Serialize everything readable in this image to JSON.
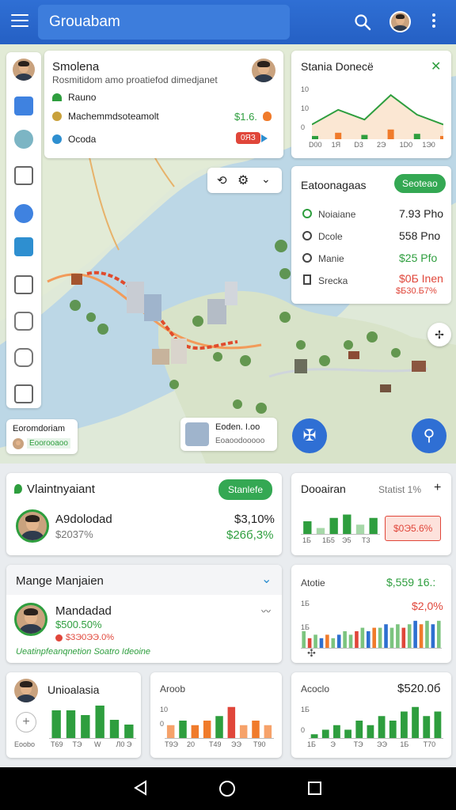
{
  "app": {
    "title": "Grouabam"
  },
  "colors": {
    "primary": "#2f6fd4",
    "green": "#2e9e3e",
    "red": "#e0463a",
    "orange": "#f07b2b"
  },
  "overview_card": {
    "title": "Smolena",
    "subtitle": "Rosmitidom amo proatiefod dimedjanet",
    "rows": [
      {
        "icon": "leaf-icon",
        "label": "Rauno",
        "value": "",
        "badge": ""
      },
      {
        "icon": "coin-icon",
        "label": "Machemmdsoteamolt",
        "value": "$1.6.",
        "badge": ""
      },
      {
        "icon": "location-icon",
        "label": "Ocoda",
        "value": "",
        "badge": "0ЯЗ"
      }
    ]
  },
  "stats_card": {
    "title": "Stania Doneсё",
    "x_labels": [
      "D00",
      "1Я",
      "D3",
      "2Э",
      "1D0",
      "1Э0"
    ],
    "y_labels": [
      "10",
      "10",
      "0"
    ],
    "chart_data": {
      "type": "area",
      "categories": [
        "D00",
        "1Я",
        "D3",
        "2Э",
        "1D0",
        "1Э0"
      ],
      "series": [
        {
          "values": [
            3,
            6,
            4,
            9,
            5,
            3
          ]
        }
      ],
      "ylim": [
        0,
        10
      ]
    }
  },
  "budget_card": {
    "title": "Eatoonagaas",
    "button": "Seoteao",
    "rows": [
      {
        "icon": "location-icon",
        "label": "Noiaiane",
        "value": "7.93 Pho",
        "sub": ""
      },
      {
        "icon": "clock-icon",
        "label": "Dcole",
        "value": "558 Pno",
        "sub": ""
      },
      {
        "icon": "clock-icon",
        "label": "Manie",
        "value": "$25 Pfo",
        "sub": ""
      },
      {
        "icon": "document-icon",
        "label": "Srecka",
        "value": "$0Б Inen",
        "sub": "$Б30.Б7%"
      }
    ]
  },
  "map": {
    "controls": [
      "undo-icon",
      "settings-icon",
      "chevron-down-icon"
    ],
    "chip_left": {
      "title": "Eoromdoriam",
      "sub": "Eoorooaoo"
    },
    "chip_right": {
      "title": "Eoden. I.oo",
      "sub": "Eoaoodooooo"
    }
  },
  "maint_card": {
    "title": "Vlaintnyaiant",
    "button": "Stanlefe",
    "name": "A9dolodad",
    "sub": "$2037%",
    "value": "$3,10%",
    "value2": "$26б,3%"
  },
  "doc_card": {
    "title": "Dooairan",
    "right": "Statist 1%",
    "badge": "$0Э5.6%",
    "x_labels": [
      "1Б",
      "1Б5",
      "Э5",
      "Т3"
    ],
    "chart_data": {
      "type": "bar",
      "categories": [
        "1Б",
        "1Б5",
        "Э5",
        "Т3"
      ],
      "series": [
        {
          "values": [
            4,
            2,
            5,
            6,
            3,
            5
          ]
        }
      ],
      "ylim": [
        0,
        8
      ]
    }
  },
  "manage_card": {
    "title": "Mange Manjaien",
    "name": "Mandadad",
    "v1": "$500.50%",
    "v2": "$3Э0ЭЭ.0%",
    "footer": "Ueatinpfeanqnetion Soatro Ideoine"
  },
  "trend_card": {
    "title": "Atotie",
    "value": "$,559 16.:",
    "value2": "$2,0%",
    "y_labels": [
      "1Б",
      "1Б"
    ],
    "chart_data": {
      "type": "bar",
      "series": [
        {
          "values": [
            5,
            3,
            4,
            3,
            4,
            3,
            4,
            5,
            4,
            5,
            6,
            5,
            6,
            6,
            7,
            6,
            7,
            6,
            7,
            8,
            7,
            8,
            7,
            8
          ]
        }
      ],
      "ylim": [
        0,
        10
      ]
    }
  },
  "bottom_left": {
    "title": "Unioalasia",
    "foot": "Eoobo",
    "x_labels": [
      "Т69",
      "ТЭ",
      "W",
      "Л0 Э"
    ],
    "chart_data": {
      "type": "bar",
      "series": [
        {
          "values": [
            6,
            6,
            5,
            7,
            4,
            3
          ]
        }
      ],
      "ylim": [
        0,
        8
      ]
    }
  },
  "bottom_mid": {
    "title": "Aroob",
    "x_labels": [
      "Т9Э",
      "20",
      "Т49",
      "ЭЭ",
      "Т90"
    ],
    "y_labels": [
      "10",
      "0"
    ],
    "chart_data": {
      "type": "bar",
      "series": [
        {
          "values": [
            3,
            4,
            3,
            4,
            5,
            7,
            3,
            4,
            3
          ]
        }
      ],
      "ylim": [
        0,
        8
      ]
    }
  },
  "bottom_right": {
    "title": "Acoclo",
    "value": "$520.0б",
    "x_labels": [
      "1Б",
      "Э",
      "ТЭ",
      "ЭЭ",
      "1Б",
      "Т70"
    ],
    "y_labels": [
      "1Б",
      "0"
    ],
    "chart_data": {
      "type": "bar",
      "series": [
        {
          "values": [
            1,
            2,
            3,
            2,
            4,
            3,
            5,
            4,
            6,
            7,
            5,
            6
          ]
        }
      ],
      "ylim": [
        0,
        8
      ]
    }
  }
}
